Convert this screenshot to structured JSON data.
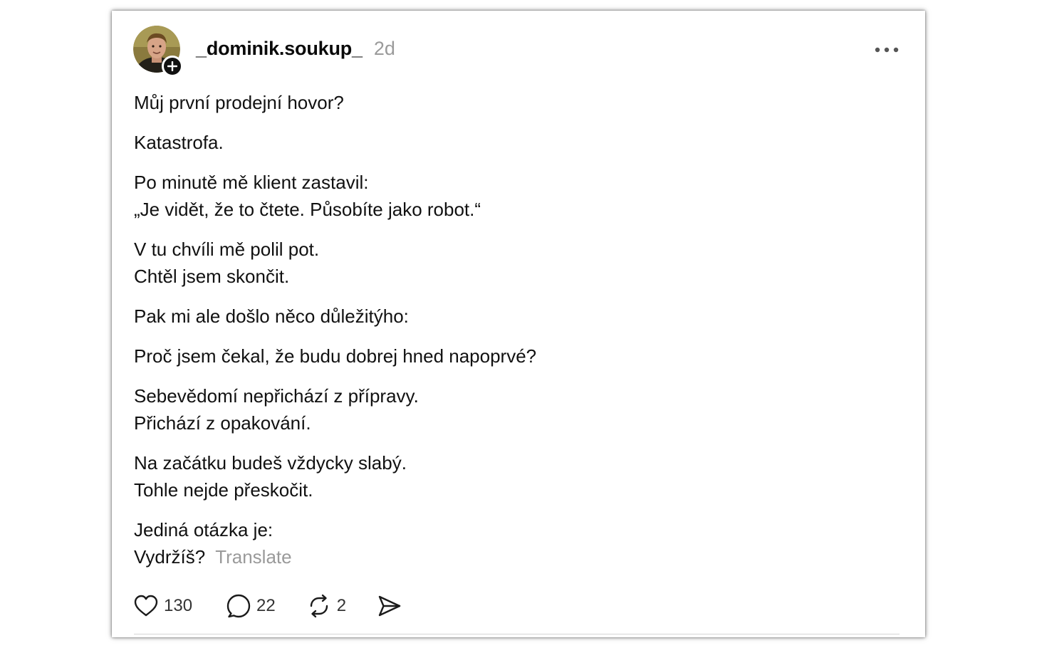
{
  "post": {
    "author": {
      "username": "_dominik.soukup_",
      "avatar_icon": "user-avatar"
    },
    "timestamp": "2d",
    "menu_icon": "more-horizontal-icon",
    "paragraphs": [
      [
        "Můj první prodejní hovor?"
      ],
      [
        "Katastrofa."
      ],
      [
        "Po minutě mě klient zastavil:",
        "„Je vidět, že to čtete. Působíte jako robot.“"
      ],
      [
        "V tu chvíli mě polil pot.",
        "Chtěl jsem skončit."
      ],
      [
        "Pak mi ale došlo něco důležitýho:"
      ],
      [
        "Proč jsem čekal, že budu dobrej hned napoprvé?"
      ],
      [
        "Sebevědomí nepřichází z přípravy.",
        "Přichází z opakování."
      ],
      [
        "Na začátku budeš vždycky slabý.",
        "Tohle nejde přeskočit."
      ],
      [
        "Jediná otázka je:",
        "Vydržíš?"
      ]
    ],
    "translate_label": "Translate",
    "actions": {
      "likes": "130",
      "replies": "22",
      "reposts": "2"
    },
    "colors": {
      "text": "#111111",
      "muted": "#9a9a9a",
      "badge": "#111111"
    }
  }
}
